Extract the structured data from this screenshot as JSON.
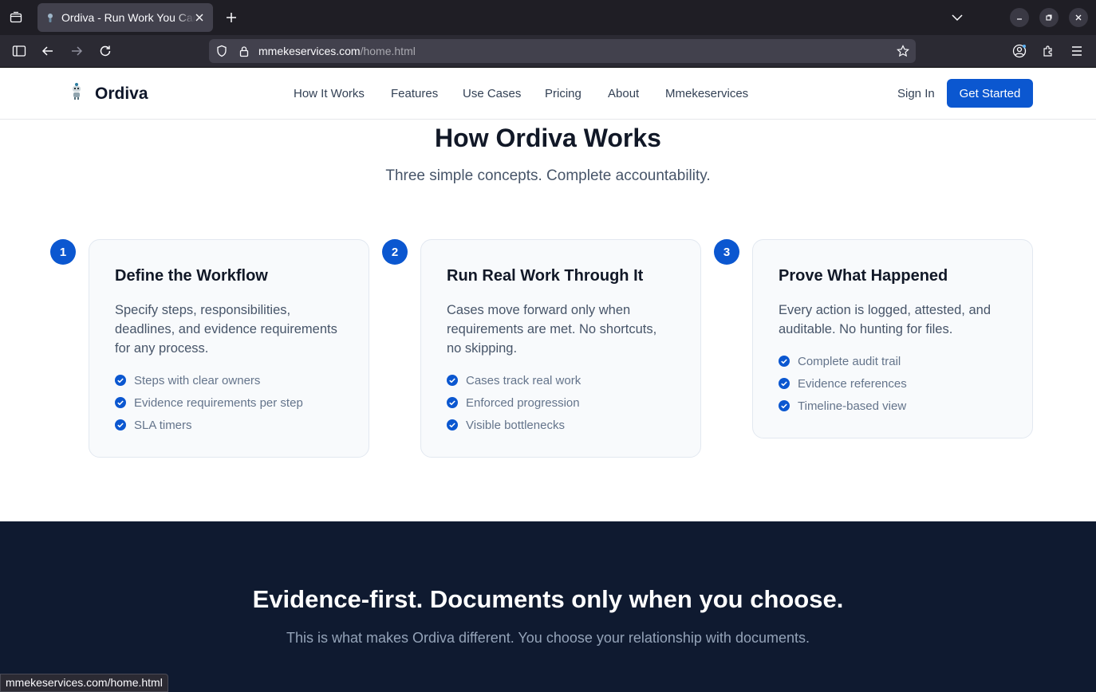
{
  "browser": {
    "tab": {
      "title": "Ordiva - Run Work You Can Prove"
    },
    "url": {
      "domain": "mmekeservices.com",
      "path": "/home.html"
    },
    "status_url": "mmekeservices.com/home.html"
  },
  "site": {
    "brand": "Ordiva",
    "nav": [
      "How It Works",
      "Features",
      "Use Cases",
      "Pricing",
      "About",
      "Mmekeservices"
    ],
    "sign_in": "Sign In",
    "get_started": "Get Started"
  },
  "how_it_works": {
    "title": "How Ordiva Works",
    "subtitle": "Three simple concepts. Complete accountability.",
    "steps": [
      {
        "number": "1",
        "title": "Define the Workflow",
        "description": "Specify steps, responsibilities, deadlines, and evidence requirements for any process.",
        "bullets": [
          "Steps with clear owners",
          "Evidence requirements per step",
          "SLA timers"
        ]
      },
      {
        "number": "2",
        "title": "Run Real Work Through It",
        "description": "Cases move forward only when requirements are met. No shortcuts, no skipping.",
        "bullets": [
          "Cases track real work",
          "Enforced progression",
          "Visible bottlenecks"
        ]
      },
      {
        "number": "3",
        "title": "Prove What Happened",
        "description": "Every action is logged, attested, and auditable. No hunting for files.",
        "bullets": [
          "Complete audit trail",
          "Evidence references",
          "Timeline-based view"
        ]
      }
    ]
  },
  "evidence": {
    "title": "Evidence-first. Documents only when you choose.",
    "subtitle": "This is what makes Ordiva different. You choose your relationship with documents."
  },
  "colors": {
    "accent": "#0b57d0",
    "dark_bg": "#0f1a30",
    "chrome_bg": "#1f1e25"
  }
}
